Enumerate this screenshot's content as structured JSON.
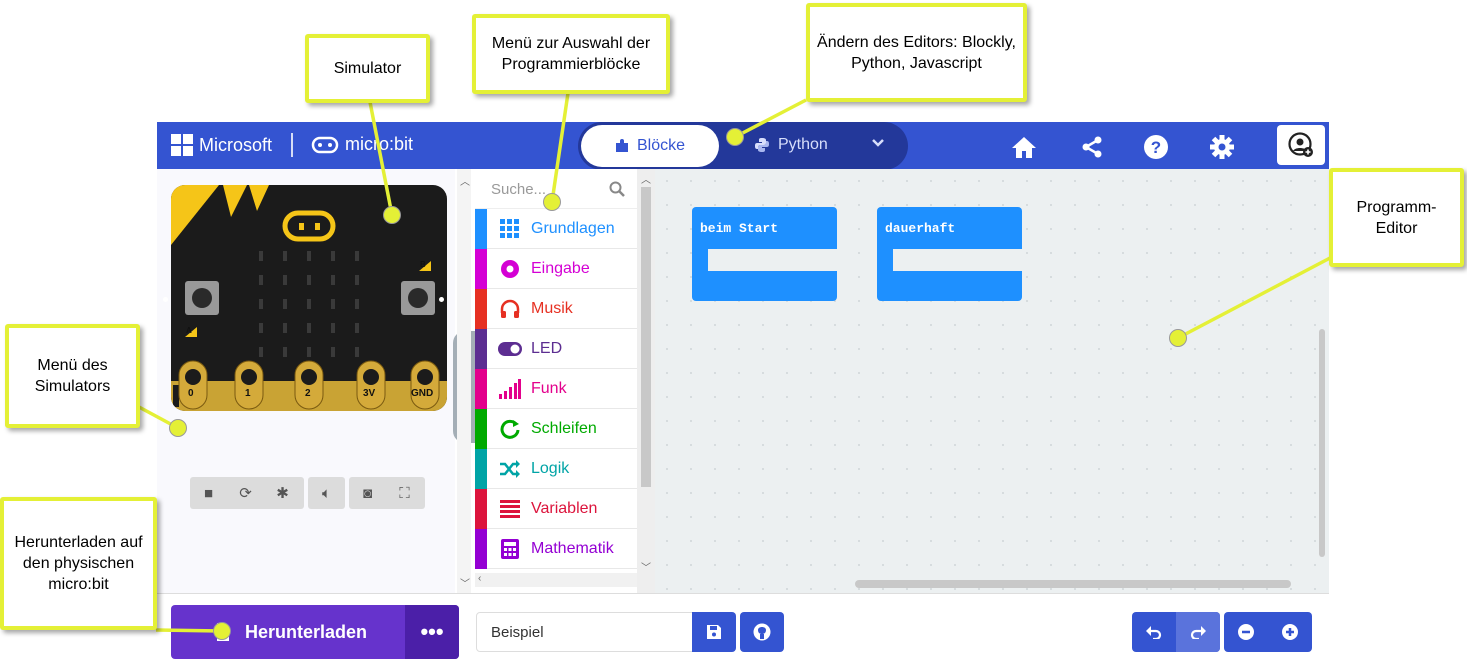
{
  "topbar": {
    "brand_microsoft": "Microsoft",
    "brand_microbit": "micro:bit",
    "editor_blocks_label": "Blöcke",
    "editor_python_label": "Python",
    "icons": [
      "home-icon",
      "share-icon",
      "help-icon",
      "settings-icon",
      "user-icon"
    ]
  },
  "simulator": {
    "pins": [
      "0",
      "1",
      "2",
      "3V",
      "GND"
    ],
    "button_a": "A",
    "button_b": "B",
    "controls": [
      "stop",
      "restart",
      "debug",
      "mute",
      "screenshot",
      "fullscreen"
    ]
  },
  "toolbox": {
    "search_placeholder": "Suche...",
    "categories": [
      {
        "label": "Grundlagen",
        "color": "#1e90ff"
      },
      {
        "label": "Eingabe",
        "color": "#d400d4"
      },
      {
        "label": "Musik",
        "color": "#e63022"
      },
      {
        "label": "LED",
        "color": "#5c2d91"
      },
      {
        "label": "Funk",
        "color": "#e3008c"
      },
      {
        "label": "Schleifen",
        "color": "#00aa00"
      },
      {
        "label": "Logik",
        "color": "#00a4a6"
      },
      {
        "label": "Variablen",
        "color": "#dc143c"
      },
      {
        "label": "Mathematik",
        "color": "#9400d3"
      }
    ]
  },
  "workspace": {
    "blocks": [
      {
        "label": "beim Start"
      },
      {
        "label": "dauerhaft"
      }
    ]
  },
  "footer": {
    "download_label": "Herunterladen",
    "more_label": "•••",
    "project_name": "Beispiel"
  },
  "annotations": {
    "simulator": "Simulator",
    "toolbox_menu": "Menü zur Auswahl der Programmierblöcke",
    "editor_switch": "Ändern des Editors: Blockly, Python, Javascript",
    "program_editor": "Programm-Editor",
    "simulator_menu": "Menü des Simulators",
    "download": "Herunterladen auf den physischen micro:bit"
  },
  "colors": {
    "accent": "#3454d1",
    "download": "#6633cc",
    "callout_border": "#e4f036",
    "block": "#1e90ff"
  }
}
